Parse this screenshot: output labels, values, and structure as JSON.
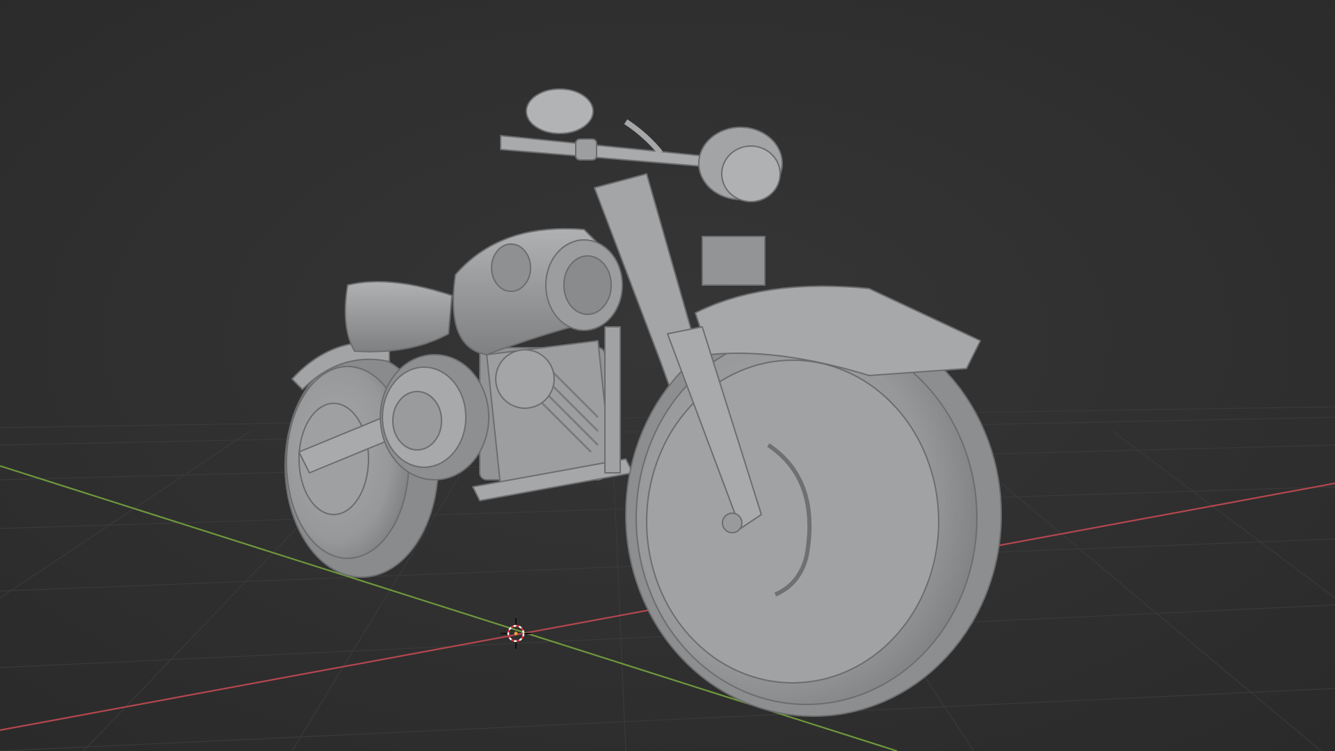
{
  "app": "3D Viewport",
  "viewport": {
    "shading": "solid",
    "background_color": "#2f2f2f",
    "grid_color": "#3b3b3b",
    "x_axis_color": "#b5474f",
    "y_axis_color": "#6f9a3c",
    "model_color": "#9a9b9d",
    "model_name": "motorcycle",
    "cursor": "3d-cursor-icon"
  }
}
